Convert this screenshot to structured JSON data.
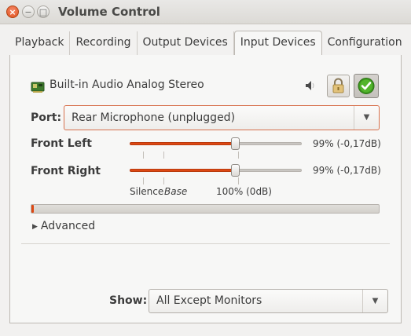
{
  "window": {
    "title": "Volume Control",
    "close_glyph": "×",
    "minimize_glyph": "−",
    "maximize_glyph": "□"
  },
  "tabs": [
    {
      "label": "Playback",
      "active": false
    },
    {
      "label": "Recording",
      "active": false
    },
    {
      "label": "Output Devices",
      "active": false
    },
    {
      "label": "Input Devices",
      "active": true
    },
    {
      "label": "Configuration",
      "active": false
    }
  ],
  "device": {
    "name": "Built-in Audio Analog Stereo",
    "icon": "sound-card-icon",
    "mute_icon": "speaker-icon",
    "lock_icon": "padlock-icon",
    "default_icon": "checkmark-icon",
    "lock_active": true,
    "default_active": true
  },
  "port": {
    "label": "Port:",
    "value": "Rear Microphone (unplugged)",
    "arrow": "▼"
  },
  "channels": [
    {
      "label": "Front Left",
      "value_text": "99% (-0,17dB)",
      "level": 0.61
    },
    {
      "label": "Front Right",
      "value_text": "99% (-0,17dB)",
      "level": 0.61
    }
  ],
  "scale_marks": {
    "silence": "Silence",
    "base": "Base",
    "hundred": "100% (0dB)"
  },
  "meter": {
    "level": 0.005
  },
  "advanced": {
    "label": "Advanced",
    "arrow": "▶"
  },
  "show": {
    "label": "Show:",
    "value": "All Except Monitors",
    "arrow": "▼"
  },
  "colors": {
    "accent": "#dd4814",
    "check_green": "#3d9a1f",
    "port_border": "#d7714d"
  }
}
